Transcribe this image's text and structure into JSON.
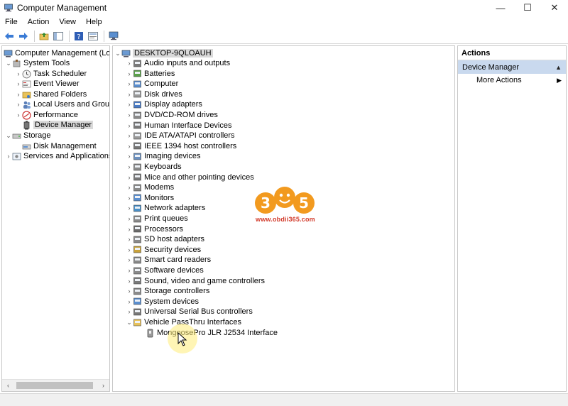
{
  "window": {
    "title": "Computer Management",
    "controls": {
      "minimize": "—",
      "maximize": "☐",
      "close": "✕"
    }
  },
  "menu": [
    "File",
    "Action",
    "View",
    "Help"
  ],
  "toolbar": {
    "buttons": [
      "back-icon",
      "forward-icon",
      "up-folder-icon",
      "show-hide-tree-icon",
      "help-icon",
      "properties-icon",
      "monitor-icon"
    ]
  },
  "left_tree": {
    "root": "Computer Management (Local",
    "items": [
      {
        "label": "System Tools",
        "icon": "tools-icon"
      },
      {
        "label": "Task Scheduler",
        "icon": "clock-icon"
      },
      {
        "label": "Event Viewer",
        "icon": "event-viewer-icon"
      },
      {
        "label": "Shared Folders",
        "icon": "shared-folder-icon"
      },
      {
        "label": "Local Users and Groups",
        "icon": "users-icon"
      },
      {
        "label": "Performance",
        "icon": "performance-icon"
      },
      {
        "label": "Device Manager",
        "icon": "device-manager-icon"
      },
      {
        "label": "Storage",
        "icon": "storage-icon"
      },
      {
        "label": "Disk Management",
        "icon": "disk-icon"
      },
      {
        "label": "Services and Applications",
        "icon": "services-icon"
      }
    ]
  },
  "device_tree": {
    "computer_name": "DESKTOP-9QLOAUH",
    "categories": [
      "Audio inputs and outputs",
      "Batteries",
      "Computer",
      "Disk drives",
      "Display adapters",
      "DVD/CD-ROM drives",
      "Human Interface Devices",
      "IDE ATA/ATAPI controllers",
      "IEEE 1394 host controllers",
      "Imaging devices",
      "Keyboards",
      "Mice and other pointing devices",
      "Modems",
      "Monitors",
      "Network adapters",
      "Print queues",
      "Processors",
      "SD host adapters",
      "Security devices",
      "Smart card readers",
      "Software devices",
      "Sound, video and game controllers",
      "Storage controllers",
      "System devices",
      "Universal Serial Bus controllers",
      "Vehicle PassThru Interfaces"
    ],
    "expanded_child": "MongoosePro JLR J2534 Interface"
  },
  "actions_pane": {
    "title": "Actions",
    "section": "Device Manager",
    "items": [
      "More Actions"
    ]
  },
  "watermark": {
    "logo": "365",
    "url": "www.obdii365.com"
  },
  "colors": {
    "selection": "#d9d9d9",
    "actions_header": "#c9d9ee",
    "watermark_orange": "#f29a1f",
    "watermark_red": "#d23a2a"
  }
}
